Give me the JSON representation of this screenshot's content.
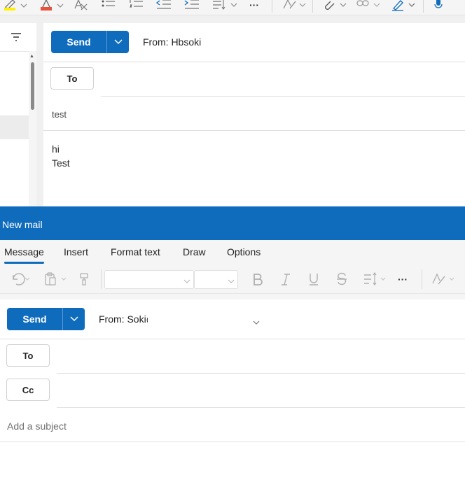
{
  "top_toolbar": {
    "icons": [
      "highlight-icon",
      "font-color-icon",
      "clear-format-icon",
      "bullets-icon",
      "numbering-icon",
      "decrease-indent-icon",
      "increase-indent-icon",
      "line-spacing-icon",
      "more-icon",
      "editor-icon",
      "attach-icon",
      "link-icon",
      "signature-icon",
      "dictate-icon"
    ],
    "more_label": "···"
  },
  "reply_compose": {
    "send_label": "Send",
    "from_text": "From: Hbsoki",
    "to_label": "To",
    "subject": "test",
    "body_lines": [
      "hi",
      "Test"
    ]
  },
  "new_mail": {
    "title": "New mail",
    "tabs": [
      {
        "label": "Message",
        "active": true
      },
      {
        "label": "Insert",
        "active": false
      },
      {
        "label": "Format text",
        "active": false
      },
      {
        "label": "Draw",
        "active": false
      },
      {
        "label": "Options",
        "active": false
      }
    ],
    "toolbar": {
      "font_name": "",
      "font_size": "",
      "more_label": "···"
    },
    "send_label": "Send",
    "from_text": "From: Soki@",
    "to_label": "To",
    "cc_label": "Cc",
    "subject_placeholder": "Add a subject"
  },
  "colors": {
    "accent": "#0f6cbd",
    "toolbar_bg": "#f5f5f5",
    "highlight_yellow": "#fff100",
    "font_red": "#e8513c"
  }
}
